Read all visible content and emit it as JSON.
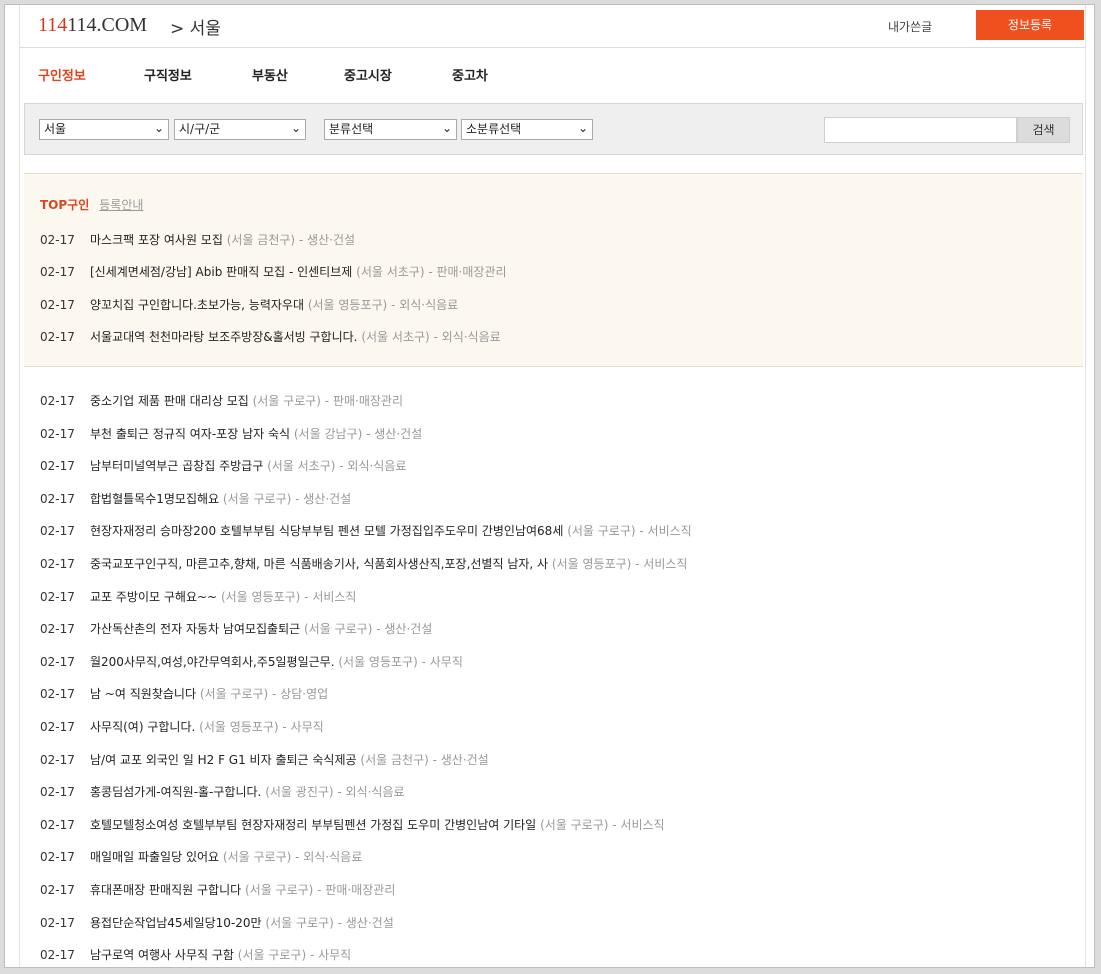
{
  "header": {
    "logo_red": "114",
    "logo_rest": "114.COM",
    "breadcrumb": "> 서울",
    "my_posts": "내가쓴글",
    "register_button": "정보등록"
  },
  "nav": {
    "tabs": [
      "구인정보",
      "구직정보",
      "부동산",
      "중고시장",
      "중고차"
    ],
    "active": "구인정보"
  },
  "filter": {
    "region": "서울",
    "district": "시/구/군",
    "category": "분류선택",
    "subcategory": "소분류선택",
    "search_value": "",
    "search_button": "검색"
  },
  "top_section": {
    "label": "TOP구인",
    "guide_link": "등록안내",
    "items": [
      {
        "date": "02-17",
        "title": "마스크팩 포장 여사원 모집",
        "meta": "(서울 금천구) - 생산·건설"
      },
      {
        "date": "02-17",
        "title": "[신세계면세점/강남] Abib 판매직 모집 - 인센티브제",
        "meta": "(서울 서초구) - 판매·매장관리"
      },
      {
        "date": "02-17",
        "title": "양꼬치집 구인합니다.초보가능, 능력자우대",
        "meta": "(서울 영등포구) - 외식·식음료"
      },
      {
        "date": "02-17",
        "title": "서울교대역 천천마라탕 보조주방장&홀서빙 구합니다.",
        "meta": "(서울 서초구) - 외식·식음료"
      }
    ]
  },
  "listings": [
    {
      "date": "02-17",
      "title": "중소기업 제품 판매 대리상 모집",
      "meta": "(서울 구로구) - 판매·매장관리"
    },
    {
      "date": "02-17",
      "title": "부천 출퇴근 정규직 여자-포장 남자 숙식",
      "meta": "(서울 강남구) - 생산·건설"
    },
    {
      "date": "02-17",
      "title": "남부터미널역부근 곱창집 주방급구",
      "meta": "(서울 서초구) - 외식·식음료"
    },
    {
      "date": "02-17",
      "title": "합법혈틀목수1명모집해요",
      "meta": "(서울 구로구) - 생산·건설"
    },
    {
      "date": "02-17",
      "title": "현장자재정리 승마장200 호텔부부팀 식당부부팀 펜션 모텔 가정집입주도우미 간병인남여68세",
      "meta": "(서울 구로구) - 서비스직"
    },
    {
      "date": "02-17",
      "title": "중국교포구인구직, 마른고추,향채, 마른 식품배송기사, 식품회사생산직,포장,선별직 남자, 사",
      "meta": "(서울 영등포구) - 서비스직"
    },
    {
      "date": "02-17",
      "title": "교포 주방이모 구해요~~",
      "meta": "(서울 영등포구) - 서비스직"
    },
    {
      "date": "02-17",
      "title": "가산독산촌의 전자 자동차 남여모집출퇴근",
      "meta": "(서울 구로구) - 생산·건설"
    },
    {
      "date": "02-17",
      "title": "월200사무직,여성,야간무역회사,주5일평일근무.",
      "meta": "(서울 영등포구) - 사무직"
    },
    {
      "date": "02-17",
      "title": "남 ~여 직원찾습니다",
      "meta": "(서울 구로구) - 상담·영업"
    },
    {
      "date": "02-17",
      "title": "사무직(여) 구합니다.",
      "meta": "(서울 영등포구) - 사무직"
    },
    {
      "date": "02-17",
      "title": "남/여 교포 외국인 일 H2 F G1 비자 출퇴근 숙식제공",
      "meta": "(서울 금천구) - 생산·건설"
    },
    {
      "date": "02-17",
      "title": "홍콩딤섬가게-여직원-홀-구합니다.",
      "meta": "(서울 광진구) - 외식·식음료"
    },
    {
      "date": "02-17",
      "title": "호텔모텔청소여성 호텔부부팀 현장자재정리 부부팀펜션 가정집 도우미 간병인남여 기타일",
      "meta": "(서울 구로구) - 서비스직"
    },
    {
      "date": "02-17",
      "title": "매일매일 파출일당 있어요",
      "meta": "(서울 구로구) - 외식·식음료"
    },
    {
      "date": "02-17",
      "title": "휴대폰매장 판매직원 구합니다",
      "meta": "(서울 구로구) - 판매·매장관리"
    },
    {
      "date": "02-17",
      "title": "용접단순작업남45세일당10-20만",
      "meta": "(서울 구로구) - 생산·건설"
    },
    {
      "date": "02-17",
      "title": "남구로역 여행사 사무직 구함",
      "meta": "(서울 구로구) - 사무직"
    }
  ]
}
